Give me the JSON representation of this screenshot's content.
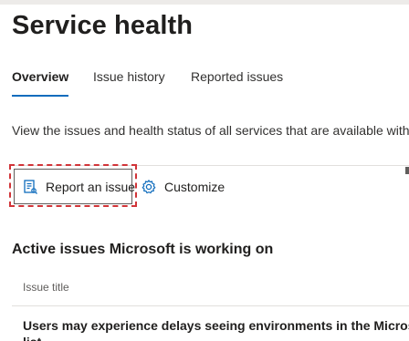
{
  "page": {
    "title": "Service health"
  },
  "tabs": [
    {
      "label": "Overview",
      "active": true
    },
    {
      "label": "Issue history",
      "active": false
    },
    {
      "label": "Reported issues",
      "active": false
    }
  ],
  "description": "View the issues and health status of all services that are available with y",
  "toolbar": {
    "report_label": "Report an issue",
    "report_icon": "report-issue-icon",
    "customize_label": "Customize",
    "customize_icon": "gear-icon"
  },
  "active_issues": {
    "heading": "Active issues Microsoft is working on",
    "column_header": "Issue title",
    "rows": [
      {
        "title_line1": "Users may experience delays seeing environments in the Microsoft",
        "title_line2": "list"
      }
    ]
  },
  "colors": {
    "accent": "#0f6cbd",
    "focus": "#d13438"
  }
}
